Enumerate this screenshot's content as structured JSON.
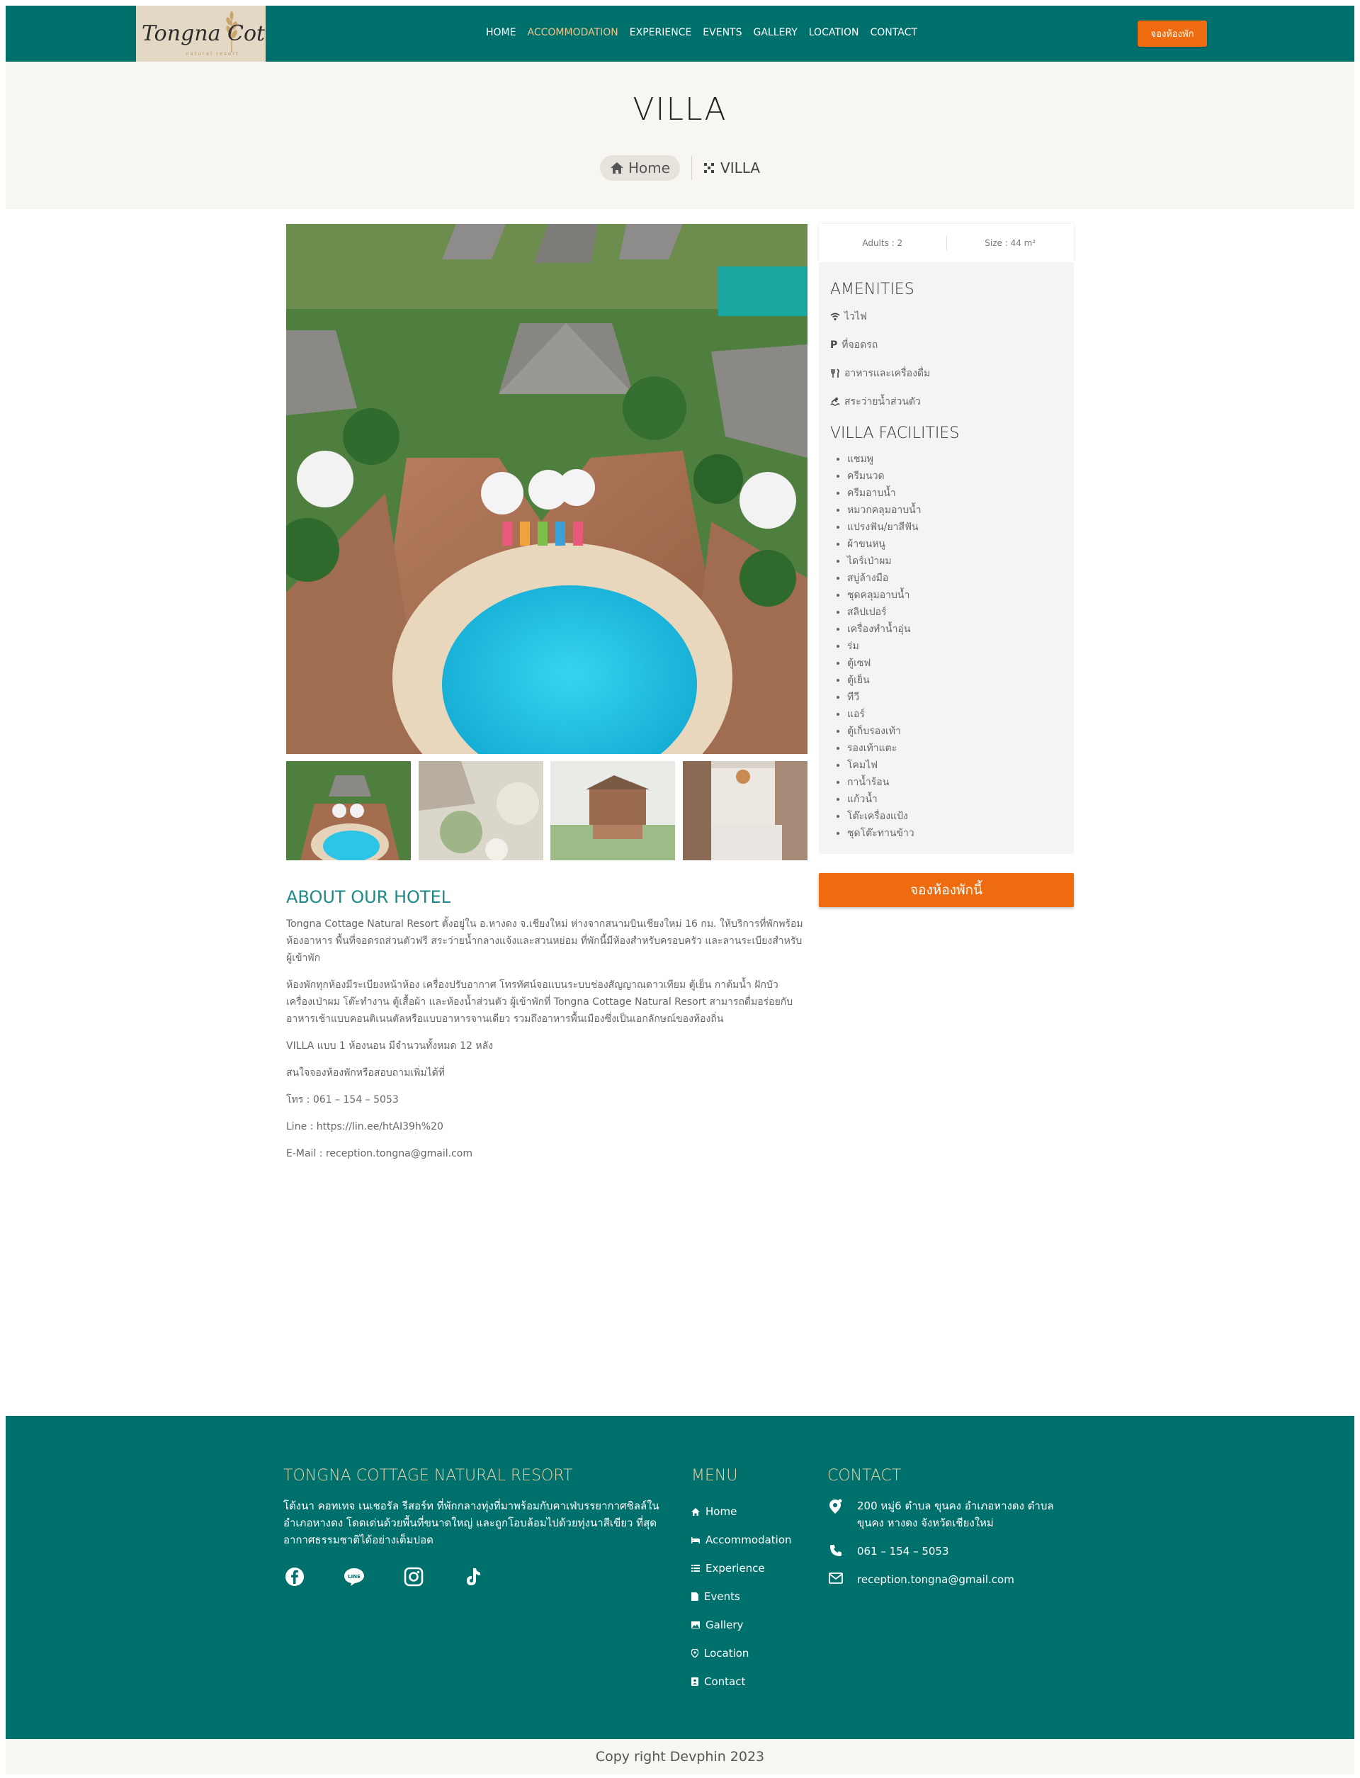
{
  "header": {
    "logo_text": "Tongna Cottage",
    "logo_tagline": "natural resort",
    "nav": [
      "HOME",
      "ACCOMMODATION",
      "EXPERIENCE",
      "EVENTS",
      "GALLERY",
      "LOCATION",
      "CONTACT"
    ],
    "active_nav": "ACCOMMODATION",
    "book_button": "จองห้องพัก"
  },
  "hero": {
    "title": "VILLA",
    "breadcrumb_home": "Home",
    "breadcrumb_current": "VILLA"
  },
  "room_info": {
    "adults": "Adults : 2",
    "size": "Size : 44 m²"
  },
  "amenities": {
    "heading": "AMENITIES",
    "items": [
      {
        "icon": "wifi-icon",
        "label": "ไวไฟ"
      },
      {
        "icon": "parking-icon",
        "label": "ที่จอดรถ"
      },
      {
        "icon": "cutlery-icon",
        "label": "อาหารและเครื่องดื่ม"
      },
      {
        "icon": "pool-icon",
        "label": "สระว่ายน้ำส่วนตัว"
      }
    ]
  },
  "facilities": {
    "heading": "VILLA FACILITIES",
    "items": [
      "แชมพู",
      "ครีมนวด",
      "ครีมอาบน้ำ",
      "หมวกคลุมอาบน้ำ",
      "แปรงฟัน/ยาสีฟัน",
      "ผ้าขนหนู",
      "ไดร์เป่าผม",
      "สบู่ล้างมือ",
      "ชุดคลุมอาบน้ำ",
      "สลิปเปอร์",
      "เครื่องทำน้ำอุ่น",
      "ร่ม",
      "ตู้เซฟ",
      "ตู้เย็น",
      "ทีวี",
      "แอร์",
      "ตู้เก็บรองเท้า",
      "รองเท้าแตะ",
      "โคมไฟ",
      "กาน้ำร้อน",
      "แก้วน้ำ",
      "โต๊ะเครื่องแป้ง",
      "ชุดโต๊ะทานข้าว"
    ]
  },
  "book_now": "จองห้องพักนี้",
  "about": {
    "heading": "ABOUT OUR HOTEL",
    "paragraphs": [
      "Tongna Cottage Natural Resort ตั้งอยู่ใน อ.หางดง จ.เชียงใหม่ ห่างจากสนามบินเชียงใหม่ 16 กม. ให้บริการที่พักพร้อมห้องอาหาร พื้นที่จอดรถส่วนตัวฟรี สระว่ายน้ำกลางแจ้งและสวนหย่อม ที่พักนี้มีห้องสำหรับครอบครัว และลานระเบียงสำหรับผู้เข้าพัก",
      "ห้องพักทุกห้องมีระเบียงหน้าห้อง เครื่องปรับอากาศ โทรทัศน์จอแบนระบบช่องสัญญาณดาวเทียม ตู้เย็น กาต้มน้ำ ฝักบัว เครื่องเป่าผม โต๊ะทำงาน ตู้เสื้อผ้า และห้องน้ำส่วนตัว ผู้เข้าพักที่ Tongna Cottage Natural Resort สามารถดื่มอร่อยกับอาหารเช้าแบบคอนติเนนตัลหรือแบบอาหารจานเดียว รวมถึงอาหารพื้นเมืองซึ่งเป็นเอกลักษณ์ของท้องถิ่น",
      "VILLA แบบ 1 ห้องนอน มีจำนวนทั้งหมด 12 หลัง",
      "สนใจจองห้องพักหรือสอบถามเพิ่มได้ที่",
      "โทร : 061 – 154 – 5053",
      "Line : https://lin.ee/htAI39h%20",
      "E-Mail : reception.tongna@gmail.com"
    ]
  },
  "footer": {
    "brand_heading": "TONGNA COTTAGE NATURAL RESORT",
    "brand_text": "โต้งนา คอทเทจ เนเชอรัล รีสอร์ท ที่พักกลางทุ่งที่มาพร้อมกับคาเฟ่บรรยากาศชิลล์ใน อำเภอหางดง โดดเด่นด้วยพื้นที่ขนาดใหญ่ และถูกโอบล้อมไปด้วยทุ่งนาสีเขียว ที่สุดอากาศธรรมชาติได้อย่างเต็มปอด",
    "menu_heading": "MENU",
    "menu": [
      {
        "icon": "home-icon",
        "label": "Home"
      },
      {
        "icon": "bed-icon",
        "label": "Accommodation"
      },
      {
        "icon": "list-icon",
        "label": "Experience"
      },
      {
        "icon": "document-icon",
        "label": "Events"
      },
      {
        "icon": "image-icon",
        "label": "Gallery"
      },
      {
        "icon": "pin-icon",
        "label": "Location"
      },
      {
        "icon": "contact-card-icon",
        "label": "Contact"
      }
    ],
    "contact_heading": "CONTACT",
    "address": "200 หมู่6 ตำบล ขุนคง อำเภอหางดง ตำบล ขุนคง หางดง จังหวัดเชียงใหม่",
    "phone": "061 – 154 – 5053",
    "email": "reception.tongna@gmail.com"
  },
  "copyright": "Copy right Devphin 2023",
  "colors": {
    "brand_teal": "#00706d",
    "accent_orange": "#ee6b10",
    "heading_teal": "#1f8a87",
    "nav_active": "#e7c58c"
  }
}
